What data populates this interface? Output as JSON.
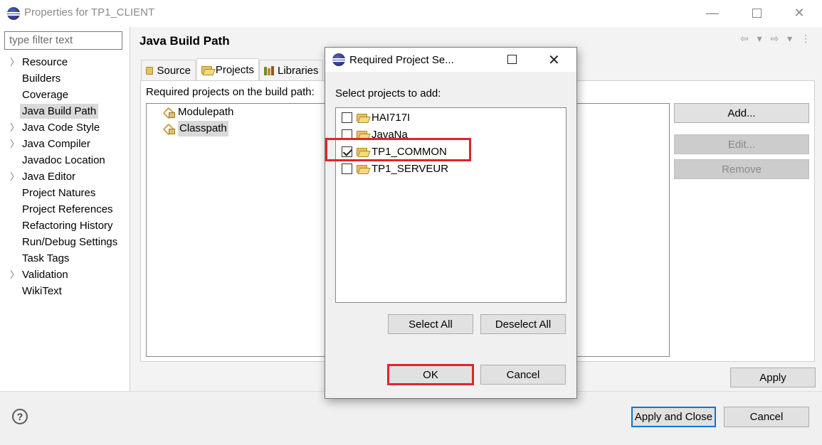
{
  "window": {
    "title": "Properties for TP1_CLIENT",
    "controls": {
      "minimize": "—",
      "close": "✕"
    }
  },
  "nav": {
    "filter_placeholder": "type filter text",
    "items": [
      {
        "label": "Resource",
        "expandable": true
      },
      {
        "label": "Builders",
        "expandable": false
      },
      {
        "label": "Coverage",
        "expandable": false
      },
      {
        "label": "Java Build Path",
        "expandable": false,
        "selected": true
      },
      {
        "label": "Java Code Style",
        "expandable": true
      },
      {
        "label": "Java Compiler",
        "expandable": true
      },
      {
        "label": "Javadoc Location",
        "expandable": false
      },
      {
        "label": "Java Editor",
        "expandable": true
      },
      {
        "label": "Project Natures",
        "expandable": false
      },
      {
        "label": "Project References",
        "expandable": false
      },
      {
        "label": "Refactoring History",
        "expandable": false
      },
      {
        "label": "Run/Debug Settings",
        "expandable": false
      },
      {
        "label": "Task Tags",
        "expandable": false
      },
      {
        "label": "Validation",
        "expandable": true
      },
      {
        "label": "WikiText",
        "expandable": false
      }
    ]
  },
  "page": {
    "title": "Java Build Path",
    "header_icons": "⇦ ▾ ⇨ ▾ ⋮",
    "tabs": [
      {
        "label": "Source",
        "icon": "source-folder-icon"
      },
      {
        "label": "Projects",
        "icon": "open-folder-icon",
        "active": true
      },
      {
        "label": "Libraries",
        "icon": "library-icon"
      }
    ],
    "required_label": "Required projects on the build path:",
    "tree_items": [
      {
        "label": "Modulepath",
        "icon": "modulepath-icon"
      },
      {
        "label": "Classpath",
        "icon": "classpath-icon",
        "selected": true
      }
    ],
    "buttons": {
      "add": "Add...",
      "edit": "Edit...",
      "remove": "Remove",
      "apply": "Apply"
    }
  },
  "footer": {
    "help": "?",
    "apply_close": "Apply and Close",
    "cancel": "Cancel"
  },
  "dialog": {
    "title": "Required Project Se...",
    "controls": {
      "close": "✕"
    },
    "label": "Select projects to add:",
    "projects": [
      {
        "name": "HAI717I",
        "checked": false
      },
      {
        "name": "JavaNa",
        "checked": false
      },
      {
        "name": "TP1_COMMON",
        "checked": true
      },
      {
        "name": "TP1_SERVEUR",
        "checked": false
      }
    ],
    "select_all": "Select All",
    "deselect_all": "Deselect All",
    "ok": "OK",
    "cancel": "Cancel"
  },
  "colors": {
    "highlight_red": "#e0242c",
    "focus_blue": "#0078d7"
  }
}
